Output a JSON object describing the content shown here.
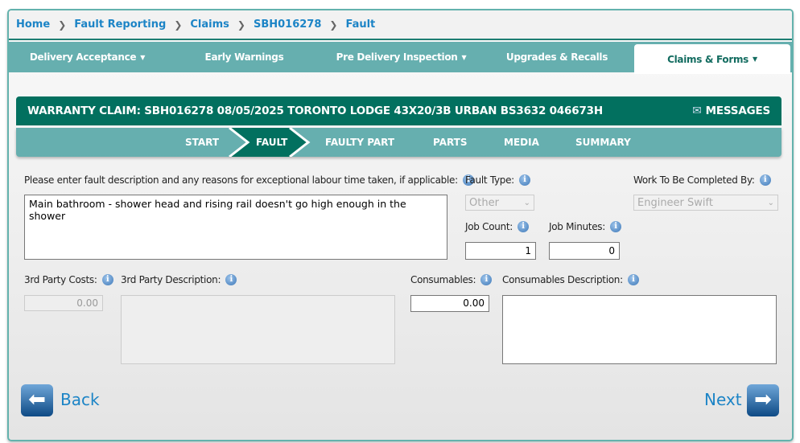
{
  "breadcrumb": [
    "Home",
    "Fault Reporting",
    "Claims",
    "SBH016278",
    "Fault"
  ],
  "nav": [
    {
      "label": "Delivery Acceptance",
      "caret": true
    },
    {
      "label": "Early Warnings",
      "caret": false
    },
    {
      "label": "Pre Delivery Inspection",
      "caret": true
    },
    {
      "label": "Upgrades & Recalls",
      "caret": false
    },
    {
      "label": "Claims & Forms",
      "caret": true,
      "active": true
    }
  ],
  "header": {
    "title": "WARRANTY CLAIM: SBH016278 08/05/2025 TORONTO LODGE 43X20/3B URBAN BS3632 046673H",
    "messages": "MESSAGES"
  },
  "steps": [
    "START",
    "FAULT",
    "FAULTY PART",
    "PARTS",
    "MEDIA",
    "SUMMARY"
  ],
  "form": {
    "fault_desc_label": "Please enter fault description and any reasons for exceptional labour time taken, if applicable:",
    "fault_desc": "Main bathroom - shower head and rising rail doesn't go high enough in the shower",
    "fault_type_label": "Fault Type:",
    "fault_type": "Other",
    "work_by_label": "Work To Be Completed By:",
    "work_by": "Engineer Swift",
    "job_count_label": "Job Count:",
    "job_count": "1",
    "job_minutes_label": "Job Minutes:",
    "job_minutes": "0",
    "third_costs_label": "3rd Party Costs:",
    "third_costs": "0.00",
    "third_desc_label": "3rd Party Description:",
    "third_desc": "",
    "consumables_label": "Consumables:",
    "consumables": "0.00",
    "consumables_desc_label": "Consumables Description:",
    "consumables_desc": ""
  },
  "back": "Back",
  "next": "Next"
}
